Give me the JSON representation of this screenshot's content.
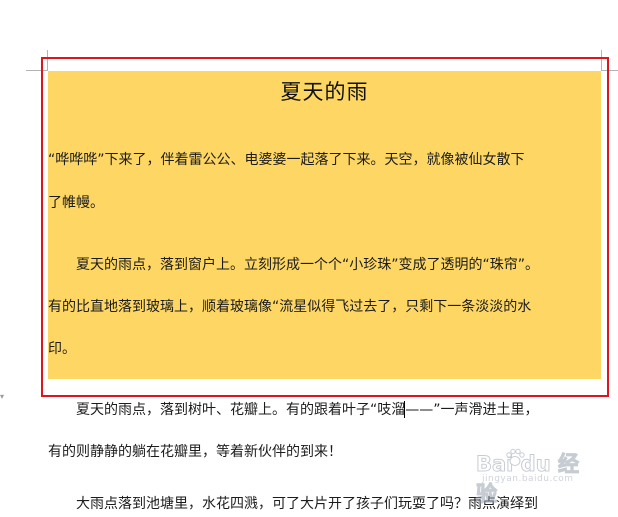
{
  "document": {
    "title": "夏天的雨",
    "paragraphs": [
      {
        "lines": [
          "“哗哗哗”下来了，伴着雷公公、电婆婆一起落了下来。天空，就像被仙女散下",
          "了帷幔。"
        ]
      },
      {
        "lines": [
          "　　夏天的雨点，落到窗户上。立刻形成一个个“小珍珠”变成了透明的“珠帘”。",
          "有的比直地落到玻璃上，顺着玻璃像“流星似得飞过去了，只剩下一条淡淡的水",
          "印。"
        ]
      },
      {
        "lines": [
          "　　夏天的雨点，落到树叶、花瓣上。有的跟着叶子“吱溜——”一声滑进土里，",
          "有的则静静的躺在花瓣里，等着新伙伴的到来！",
          "　　大雨点落到池塘里，水花四溅，可了大片开了孩子们玩耍了吗？雨点演绎到"
        ]
      }
    ]
  },
  "colors": {
    "highlight": "#fdd663",
    "selection_box": "#e0141e"
  },
  "watermark": {
    "logo": "Bai du 经验",
    "subtitle": "jingyan.baidu.com"
  }
}
